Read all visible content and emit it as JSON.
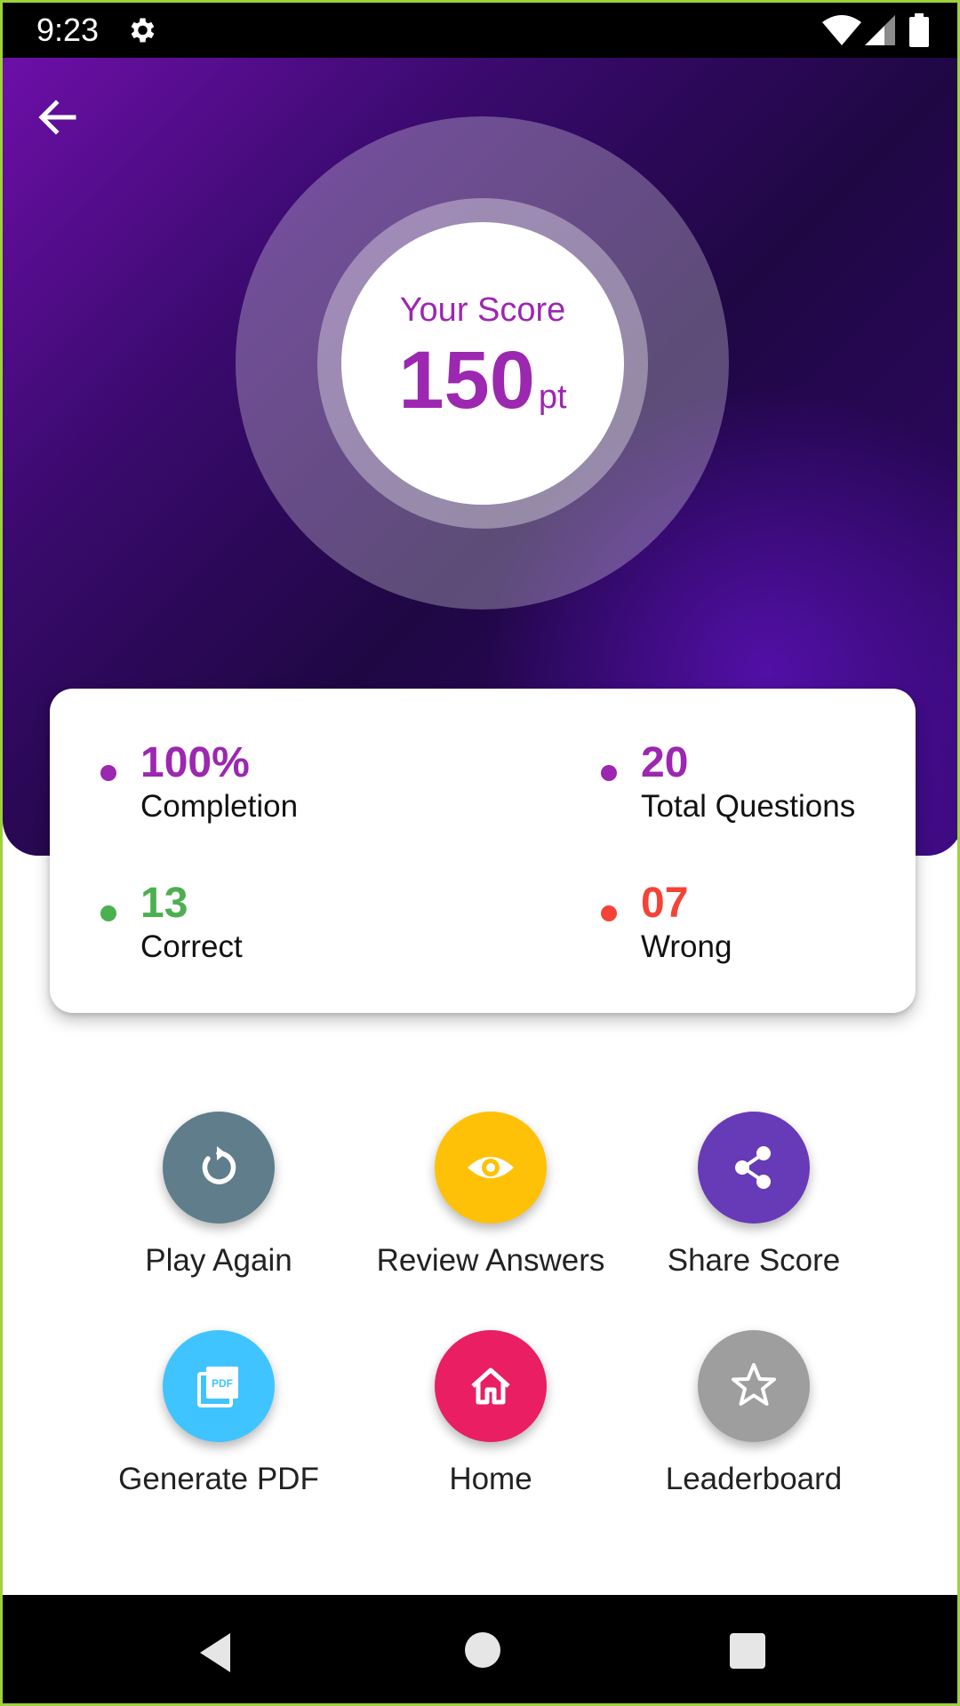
{
  "status_bar": {
    "time": "9:23",
    "icons": [
      "gear-icon",
      "wifi-icon",
      "signal-icon",
      "battery-icon"
    ]
  },
  "header": {
    "back_icon": "arrow-left-icon",
    "score_label": "Your Score",
    "score_value": "150",
    "score_unit": "pt",
    "colors": {
      "gradient_start": "#6d0fa8",
      "gradient_end": "#1f0744",
      "accent": "#9c27b0"
    }
  },
  "stats": {
    "completion": {
      "value": "100%",
      "label": "Completion",
      "color": "#9c27b0"
    },
    "total_questions": {
      "value": "20",
      "label": "Total Questions",
      "color": "#9c27b0"
    },
    "correct": {
      "value": "13",
      "label": "Correct",
      "color": "#4caf50"
    },
    "wrong": {
      "value": "07",
      "label": "Wrong",
      "color": "#f44336"
    }
  },
  "actions": [
    {
      "label": "Play Again",
      "icon": "replay-icon",
      "color": "#607d8b"
    },
    {
      "label": "Review Answers",
      "icon": "eye-icon",
      "color": "#ffc107"
    },
    {
      "label": "Share Score",
      "icon": "share-icon",
      "color": "#673ab7"
    },
    {
      "label": "Generate PDF",
      "icon": "pdf-icon",
      "color": "#40c4ff"
    },
    {
      "label": "Home",
      "icon": "home-icon",
      "color": "#e91e63"
    },
    {
      "label": "Leaderboard",
      "icon": "star-icon",
      "color": "#9e9e9e"
    }
  ],
  "nav_bar": {
    "icons": [
      "nav-back-icon",
      "nav-home-icon",
      "nav-recents-icon"
    ]
  }
}
